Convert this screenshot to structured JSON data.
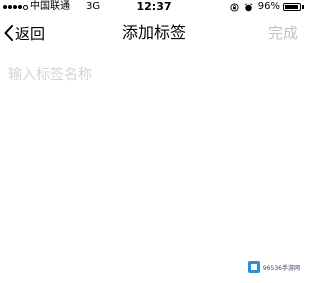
{
  "status_bar": {
    "signal_bars_filled": 4,
    "signal_bars_total": 5,
    "carrier": "中国联通",
    "network": "3G",
    "time": "12:37",
    "battery_percent": "96%",
    "battery_level": 0.96
  },
  "nav": {
    "back_label": "返回",
    "title": "添加标签",
    "done_label": "完成"
  },
  "tag_input": {
    "placeholder": "输入标签名称",
    "value": ""
  },
  "watermark": {
    "text": "96536手游网"
  },
  "colors": {
    "done_disabled": "#c2c2c2",
    "placeholder": "#d4d4d4",
    "background": "#ffffff"
  },
  "icons": {
    "back": "chevron-left-icon",
    "orientation_lock": "orientation-lock-icon",
    "alarm": "alarm-icon",
    "battery": "battery-icon"
  }
}
